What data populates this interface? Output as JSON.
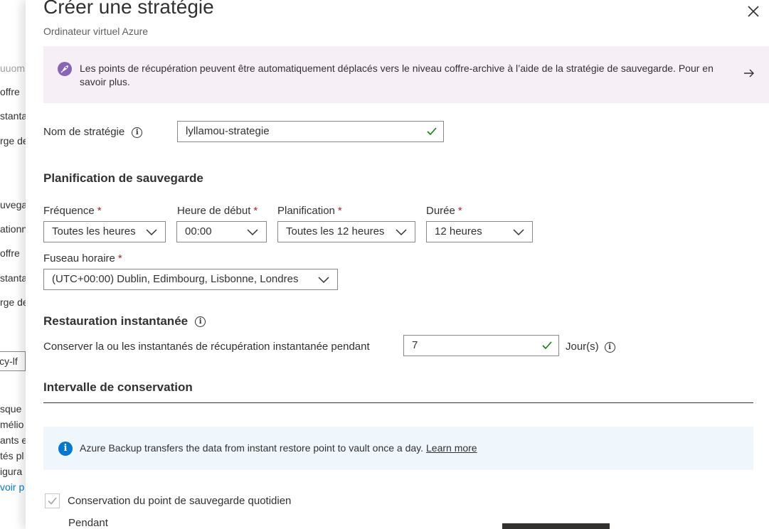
{
  "background": {
    "fragments": [
      "uuom",
      "offre",
      "stantan",
      "rge de",
      "uvega",
      "ationn",
      "offre",
      "stantan",
      "rge de",
      "icy-lf",
      "sque",
      "mélio",
      "ants e",
      "tés pl",
      "igura",
      "voir p"
    ]
  },
  "blade": {
    "title": "Créer une stratégie",
    "subtitle": "Ordinateur virtuel Azure",
    "close_icon": "close-icon"
  },
  "archive_banner": {
    "text": "Les points de récupération peuvent être automatiquement déplacés vers le niveau coffre-archive à l’aide de la stratégie de sauvegarde. Pour en savoir plus.",
    "icon": "rocket-icon",
    "arrow_icon": "arrow-right-icon",
    "color": "#f6eff6"
  },
  "policy_name": {
    "label": "Nom de stratégie",
    "value": "lyllamou-strategie"
  },
  "backup_schedule": {
    "title": "Planification de sauvegarde",
    "frequency": {
      "label": "Fréquence",
      "value": "Toutes les heures"
    },
    "start_time": {
      "label": "Heure de début",
      "value": "00:00"
    },
    "schedule": {
      "label": "Planification",
      "value": "Toutes les 12 heures"
    },
    "duration": {
      "label": "Durée",
      "value": "12 heures"
    },
    "timezone": {
      "label": "Fuseau horaire",
      "value": "(UTC+00:00) Dublin, Edimbourg, Lisbonne, Londres"
    },
    "required_marker": "*"
  },
  "instant_restore": {
    "title": "Restauration instantanée",
    "retain_label": "Conserver la ou les instantanés de récupération instantanée pendant",
    "retain_value": "7",
    "unit": "Jour(s)"
  },
  "retention": {
    "title": "Intervalle de conservation",
    "info_text": "Azure Backup transfers the data from instant restore point to vault once a day.",
    "info_link": "Learn more",
    "daily_checkbox_label": "Conservation du point de sauvegarde quotidien",
    "daily_checked": true,
    "for_label": "Pendant"
  },
  "colors": {
    "accent": "#0078d4",
    "required": "#a4262c",
    "success": "#107c10",
    "purple": "#8764b8"
  }
}
